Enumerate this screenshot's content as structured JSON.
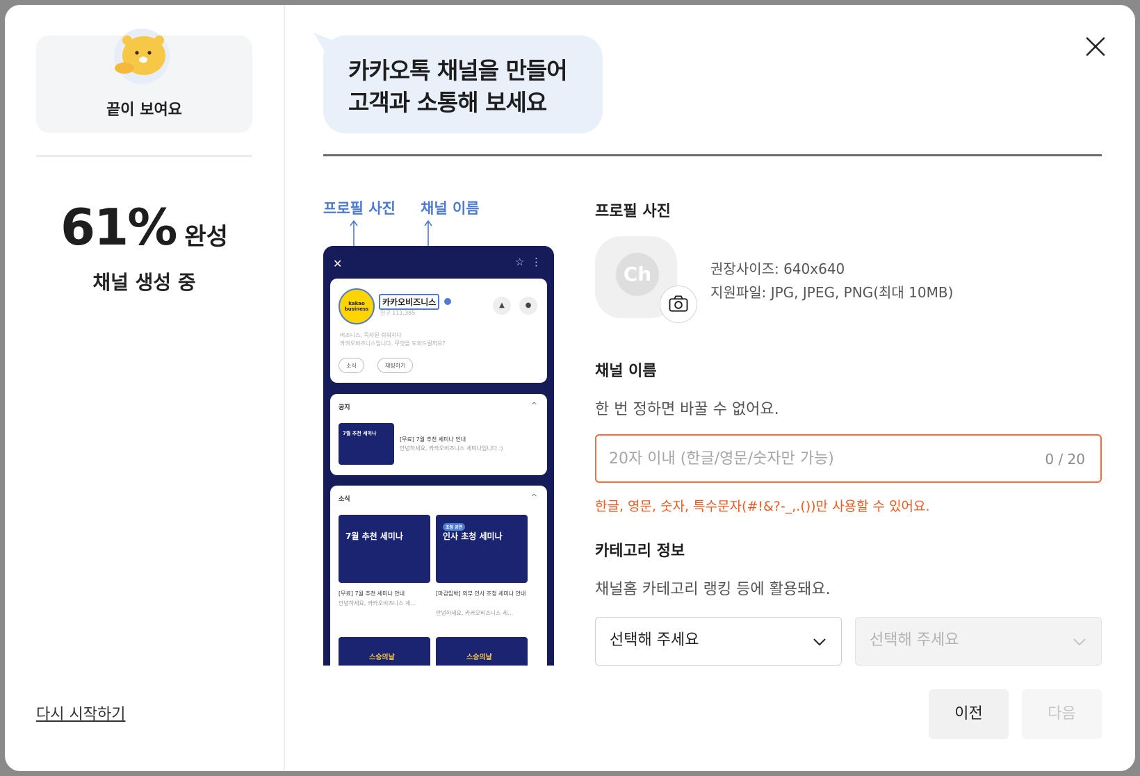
{
  "sidebar": {
    "mascot_label": "끝이 보여요",
    "progress_value": "61%",
    "progress_fraction": 0.61,
    "progress_suffix": "완성",
    "progress_sub": "채널 생성 중",
    "restart_label": "다시 시작하기"
  },
  "header": {
    "bubble_line1": "카카오톡 채널을 만들어",
    "bubble_line2": "고객과 소통해 보세요",
    "close_icon": "close-icon"
  },
  "preview": {
    "label_profile": "프로필 사진",
    "label_name": "채널 이름",
    "logo_text": "kakao business",
    "channel_name": "카카오비즈니스",
    "friends": "친구 111,385",
    "intro_line1": "비즈니스, 독자된 쉬워지다",
    "intro_line2": "카카오비즈니스입니다. 무엇을 도와드릴까요?",
    "pill_news": "소식",
    "pill_chat": "채팅하기",
    "notice_title": "공지",
    "notice_thumb": "7월 추천 세미나",
    "notice_caption": "[무료] 7월 추천 세미나 안내",
    "notice_sub": "안녕하세요, 카카오비즈니스 세미나입니다 :)",
    "news_title": "소식",
    "news_thumb1": "7월 추천 세미나",
    "news_thumb2": "인사 초청 세미나",
    "news_thumb2_badge": "초청 강연",
    "news_cap1": "[무료] 7월 추천 세미나 안내",
    "news_cap1_sub": "안녕하세요, 카카오비즈니스 세…",
    "news_cap2": "[마감임박] 외부 인사 초청 세미나 안내",
    "news_cap2_sub": "안녕하세요, 카카오비즈니스 세…",
    "bottom_thumb": "스승의날"
  },
  "form": {
    "profile_label": "프로필 사진",
    "placeholder_logo": "Ch",
    "spec_size": "권장사이즈: 640x640",
    "spec_file": "지원파일: JPG, JPEG, PNG(최대 10MB)",
    "name_label": "채널 이름",
    "name_desc": "한 번 정하면 바꿀 수 없어요.",
    "name_value": "",
    "name_placeholder": "20자 이내 (한글/영문/숫자만 가능)",
    "name_counter": "0 / 20",
    "name_error": "한글, 영문, 숫자, 특수문자(#!&?-_,.())만 사용할 수 있어요.",
    "category_label": "카테고리 정보",
    "category_desc": "채널홈 카테고리 랭킹 등에 활용돼요.",
    "category_select1": "선택해 주세요",
    "category_select2": "선택해 주세요"
  },
  "footer": {
    "prev_label": "이전",
    "next_label": "다음"
  },
  "colors": {
    "accent_blue": "#4c7bd1",
    "error_orange": "#f05a22",
    "bubble_bg": "#e9f0fa",
    "phone_navy": "#161c5a"
  }
}
